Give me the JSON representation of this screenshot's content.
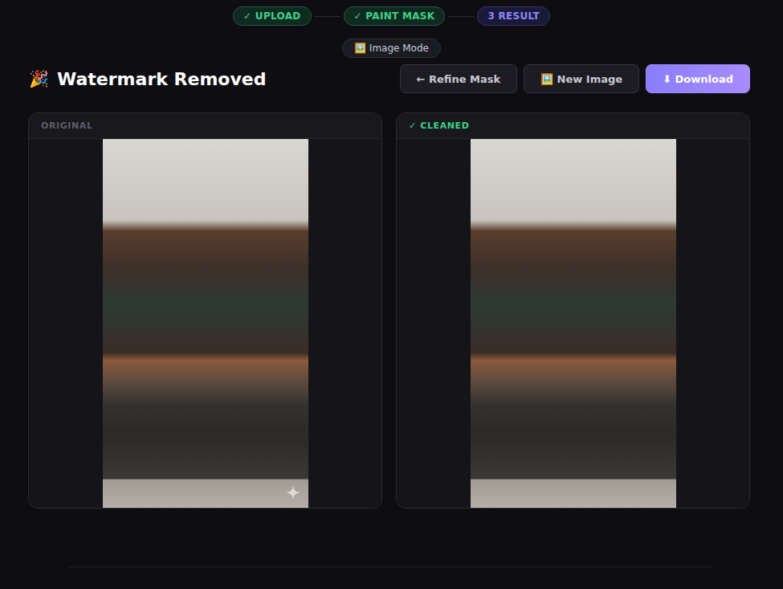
{
  "steps": [
    {
      "label": "✓ UPLOAD",
      "kind": "done",
      "selected": false
    },
    {
      "label": "✓ PAINT MASK",
      "kind": "done",
      "selected": false
    },
    {
      "label": "3 RESULT",
      "kind": "current",
      "selected": true
    }
  ],
  "mode": {
    "label": "🖼️ Image Mode"
  },
  "header": {
    "icon": "🎉",
    "title": "Watermark Removed"
  },
  "buttons": [
    {
      "label": "← Refine Mask",
      "kind": "secondary"
    },
    {
      "label": "🖼️ New Image",
      "kind": "secondary"
    },
    {
      "label": "⬇ Download",
      "kind": "primary"
    }
  ],
  "panels": [
    {
      "label": "ORIGINAL",
      "kind": "original",
      "watermark": true
    },
    {
      "label": "✓ CLEANED",
      "kind": "cleaned",
      "watermark": false
    }
  ]
}
